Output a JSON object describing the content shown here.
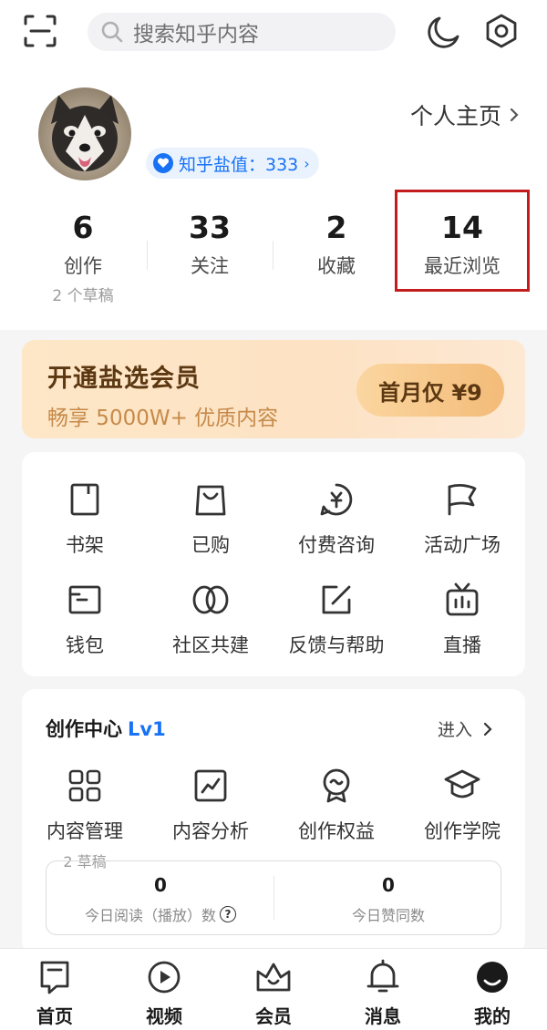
{
  "search": {
    "placeholder": "搜索知乎内容"
  },
  "profile": {
    "homepage_label": "个人主页",
    "salt_badge": "知乎盐值：333"
  },
  "stats": [
    {
      "value": "6",
      "label": "创作",
      "sub": "2 个草稿"
    },
    {
      "value": "33",
      "label": "关注"
    },
    {
      "value": "2",
      "label": "收藏"
    },
    {
      "value": "14",
      "label": "最近浏览"
    }
  ],
  "vip": {
    "title": "开通盐选会员",
    "subtitle": "畅享 5000W+ 优质内容",
    "button": "首月仅 ¥9"
  },
  "services": [
    {
      "label": "书架",
      "icon": "bookshelf-icon"
    },
    {
      "label": "已购",
      "icon": "shopping-bag-icon"
    },
    {
      "label": "付费咨询",
      "icon": "paid-consult-icon"
    },
    {
      "label": "活动广场",
      "icon": "flag-icon"
    },
    {
      "label": "钱包",
      "icon": "wallet-icon"
    },
    {
      "label": "社区共建",
      "icon": "community-icon"
    },
    {
      "label": "反馈与帮助",
      "icon": "feedback-icon"
    },
    {
      "label": "直播",
      "icon": "live-tv-icon"
    }
  ],
  "creator": {
    "title": "创作中心",
    "level": "Lv1",
    "enter": "进入",
    "items": [
      {
        "label": "内容管理",
        "icon": "grid-icon",
        "sub": "2 草稿"
      },
      {
        "label": "内容分析",
        "icon": "analytics-icon"
      },
      {
        "label": "创作权益",
        "icon": "badge-icon"
      },
      {
        "label": "创作学院",
        "icon": "graduation-cap-icon"
      }
    ],
    "today": [
      {
        "value": "0",
        "label": "今日阅读（播放）数"
      },
      {
        "value": "0",
        "label": "今日赞同数"
      }
    ]
  },
  "tabbar": [
    {
      "label": "首页",
      "icon": "home-icon"
    },
    {
      "label": "视频",
      "icon": "video-play-icon"
    },
    {
      "label": "会员",
      "icon": "crown-icon"
    },
    {
      "label": "消息",
      "icon": "bell-icon"
    },
    {
      "label": "我的",
      "icon": "profile-face-icon"
    }
  ]
}
